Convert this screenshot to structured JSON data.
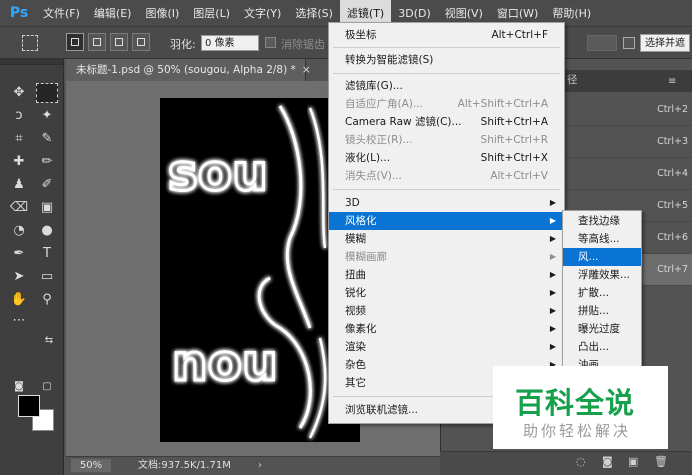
{
  "app": {
    "logo": "Ps",
    "brand_color": "#31a8ff"
  },
  "menubar": {
    "items": [
      {
        "label": "文件(F)"
      },
      {
        "label": "编辑(E)"
      },
      {
        "label": "图像(I)"
      },
      {
        "label": "图层(L)"
      },
      {
        "label": "文字(Y)"
      },
      {
        "label": "选择(S)"
      },
      {
        "label": "滤镜(T)",
        "active": true
      },
      {
        "label": "3D(D)"
      },
      {
        "label": "视图(V)"
      },
      {
        "label": "窗口(W)"
      },
      {
        "label": "帮助(H)"
      }
    ]
  },
  "options": {
    "feather_label": "羽化:",
    "feather_value": "0 像素",
    "antialias_label": "消除锯齿",
    "refine_button": "选择并遮"
  },
  "document": {
    "tab_title": "未标题-1.psd @ 50% (sougou, Alpha 2/8) *",
    "close_glyph": "×",
    "zoom": "50%",
    "doc_info": "文档:937.5K/1.71M",
    "canvas_text_top": "sou",
    "canvas_text_bottom": "nou"
  },
  "filter_menu": {
    "items": [
      {
        "label": "极坐标",
        "shortcut": "Alt+Ctrl+F",
        "disabled": false
      },
      {
        "label": "转换为智能滤镜(S)",
        "shortcut": "",
        "disabled": false
      },
      {
        "label": "滤镜库(G)...",
        "shortcut": "",
        "disabled": false
      },
      {
        "label": "自适应广角(A)...",
        "shortcut": "Alt+Shift+Ctrl+A",
        "disabled": true
      },
      {
        "label": "Camera Raw 滤镜(C)...",
        "shortcut": "Shift+Ctrl+A",
        "disabled": false
      },
      {
        "label": "镜头校正(R)...",
        "shortcut": "Shift+Ctrl+R",
        "disabled": true
      },
      {
        "label": "液化(L)...",
        "shortcut": "Shift+Ctrl+X",
        "disabled": false
      },
      {
        "label": "消失点(V)...",
        "shortcut": "Alt+Ctrl+V",
        "disabled": true
      },
      {
        "label": "3D",
        "submenu": true,
        "disabled": false
      },
      {
        "label": "风格化",
        "submenu": true,
        "highlighted": true
      },
      {
        "label": "模糊",
        "submenu": true
      },
      {
        "label": "模糊画廊",
        "submenu": true,
        "disabled": true
      },
      {
        "label": "扭曲",
        "submenu": true
      },
      {
        "label": "锐化",
        "submenu": true
      },
      {
        "label": "视频",
        "submenu": true
      },
      {
        "label": "像素化",
        "submenu": true
      },
      {
        "label": "渲染",
        "submenu": true
      },
      {
        "label": "杂色",
        "submenu": true
      },
      {
        "label": "其它",
        "submenu": true
      },
      {
        "label": "浏览联机滤镜...",
        "shortcut": ""
      }
    ]
  },
  "stylize_submenu": {
    "items": [
      {
        "label": "查找边缘"
      },
      {
        "label": "等高线..."
      },
      {
        "label": "风...",
        "highlighted": true
      },
      {
        "label": "浮雕效果..."
      },
      {
        "label": "扩散..."
      },
      {
        "label": "拼贴..."
      },
      {
        "label": "曝光过度"
      },
      {
        "label": "凸出..."
      },
      {
        "label": "油画..."
      }
    ]
  },
  "right_panel": {
    "tab_label": "径",
    "menu_glyph": "≡",
    "channel_shortcuts": [
      "Ctrl+2",
      "Ctrl+3",
      "Ctrl+4",
      "Ctrl+5",
      "Ctrl+6",
      "Ctrl+7"
    ]
  },
  "watermark": {
    "title": "百科全说",
    "subtitle": "助你轻松解决",
    "color": "#16a04b"
  },
  "colors": {
    "highlight": "#0a74d4",
    "foreground": "#000000",
    "background": "#ffffff"
  }
}
